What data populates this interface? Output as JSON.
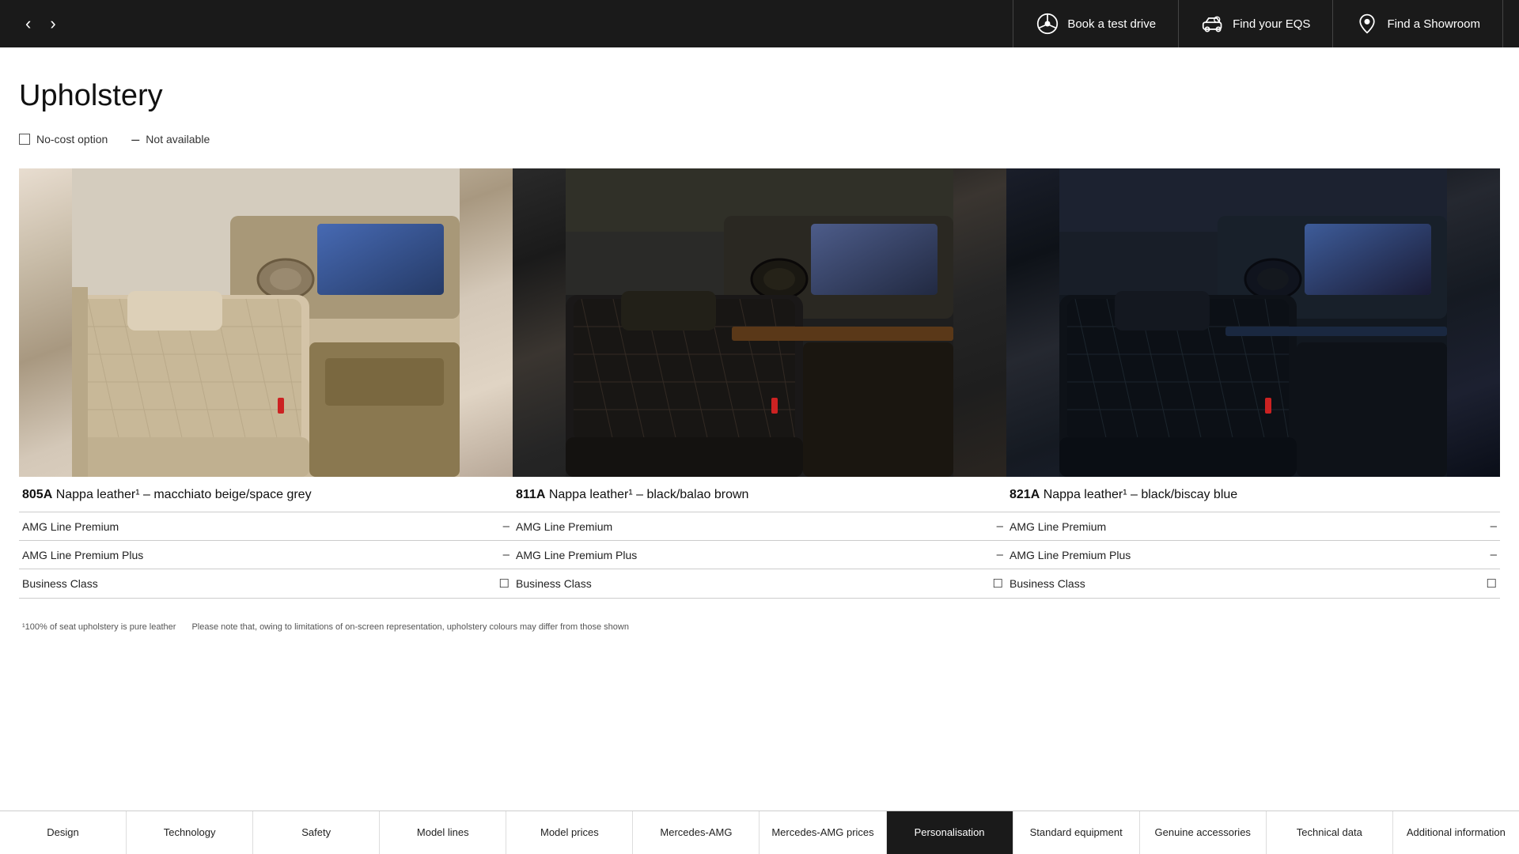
{
  "nav": {
    "prev_label": "‹",
    "next_label": "›",
    "actions": [
      {
        "id": "test-drive",
        "label": "Book a test drive",
        "icon": "steering-wheel-icon"
      },
      {
        "id": "find-eqs",
        "label": "Find your EQS",
        "icon": "car-search-icon"
      },
      {
        "id": "find-showroom",
        "label": "Find a Showroom",
        "icon": "location-icon"
      }
    ]
  },
  "page": {
    "title": "Upholstery"
  },
  "legend": {
    "no_cost": {
      "label": "No-cost option",
      "icon": "checkbox-icon"
    },
    "not_available": {
      "label": "Not available",
      "icon": "dash-icon"
    }
  },
  "cards": [
    {
      "id": "805A",
      "code": "805A",
      "description": "Nappa leather¹ – macchiato beige/space grey",
      "theme": "beige",
      "rows": [
        {
          "label": "AMG Line Premium",
          "status": "dash"
        },
        {
          "label": "AMG Line Premium Plus",
          "status": "dash"
        },
        {
          "label": "Business Class",
          "status": "box"
        }
      ]
    },
    {
      "id": "811A",
      "code": "811A",
      "description": "Nappa leather¹ – black/balao brown",
      "theme": "black",
      "rows": [
        {
          "label": "AMG Line Premium",
          "status": "dash"
        },
        {
          "label": "AMG Line Premium Plus",
          "status": "dash"
        },
        {
          "label": "Business Class",
          "status": "box"
        }
      ]
    },
    {
      "id": "821A",
      "code": "821A",
      "description": "Nappa leather¹ – black/biscay blue",
      "theme": "blue",
      "rows": [
        {
          "label": "AMG Line Premium",
          "status": "dash"
        },
        {
          "label": "AMG Line Premium Plus",
          "status": "dash"
        },
        {
          "label": "Business Class",
          "status": "box"
        }
      ]
    }
  ],
  "footnotes": [
    "¹100% of seat upholstery is pure leather",
    "Please note that, owing to limitations of on-screen representation, upholstery colours may differ from those shown"
  ],
  "bottom_nav": [
    {
      "label": "Design",
      "active": false
    },
    {
      "label": "Technology",
      "active": false
    },
    {
      "label": "Safety",
      "active": false
    },
    {
      "label": "Model lines",
      "active": false
    },
    {
      "label": "Model prices",
      "active": false
    },
    {
      "label": "Mercedes-AMG",
      "active": false
    },
    {
      "label": "Mercedes-AMG prices",
      "active": false
    },
    {
      "label": "Personalisation",
      "active": true
    },
    {
      "label": "Standard equipment",
      "active": false
    },
    {
      "label": "Genuine accessories",
      "active": false
    },
    {
      "label": "Technical data",
      "active": false
    },
    {
      "label": "Additional information",
      "active": false
    }
  ]
}
